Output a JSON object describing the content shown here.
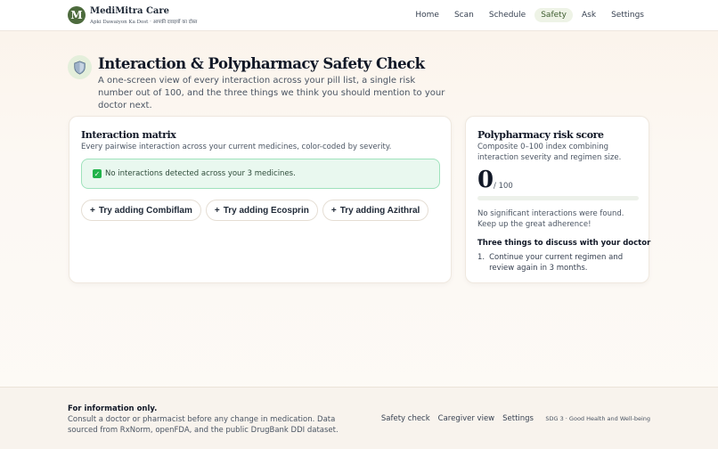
{
  "brand": {
    "logo_letter": "M",
    "name": "MediMitra Care",
    "tagline": "Apki Dawaiyon Ka Dost · आपकी दवाइयों का दोस्त"
  },
  "nav": {
    "items": [
      {
        "label": "Home"
      },
      {
        "label": "Scan"
      },
      {
        "label": "Schedule"
      },
      {
        "label": "Safety",
        "active": true
      },
      {
        "label": "Ask"
      },
      {
        "label": "Settings"
      }
    ]
  },
  "page": {
    "icon": "shield-icon",
    "title": "Interaction & Polypharmacy Safety Check",
    "subtitle": "A one-screen view of every interaction across your pill list, a single risk number out of 100, and the three things we think you should mention to your doctor next."
  },
  "matrix": {
    "title": "Interaction matrix",
    "description": "Every pairwise interaction across your current medicines, color-coded by severity.",
    "status": "No interactions detected across your 3 medicines.",
    "try_buttons": [
      {
        "label": "Try adding Combiflam"
      },
      {
        "label": "Try adding Ecosprin"
      },
      {
        "label": "Try adding Azithral"
      }
    ]
  },
  "risk": {
    "title": "Polypharmacy risk score",
    "description": "Composite 0–100 index combining interaction severity and regimen size.",
    "score": "0",
    "score_value": 0,
    "score_max": "/ 100",
    "message": "No significant interactions were found. Keep up the great adherence!",
    "discuss_heading": "Three things to discuss with your doctor",
    "discuss_items": [
      {
        "num": "1.",
        "text": "Continue your current regimen and review again in 3 months."
      }
    ]
  },
  "footer": {
    "title": "For information only.",
    "text": "Consult a doctor or pharmacist before any change in medication. Data sourced from RxNorm, openFDA, and the public DrugBank DDI dataset.",
    "links": [
      {
        "label": "Safety check"
      },
      {
        "label": "Caregiver view"
      },
      {
        "label": "Settings"
      }
    ],
    "sdg": "SDG 3 · Good Health and Well-being"
  },
  "colors": {
    "accent": "#4d6b3d",
    "success_bg": "#e9f8ef",
    "success_border": "#9fe2bc"
  }
}
